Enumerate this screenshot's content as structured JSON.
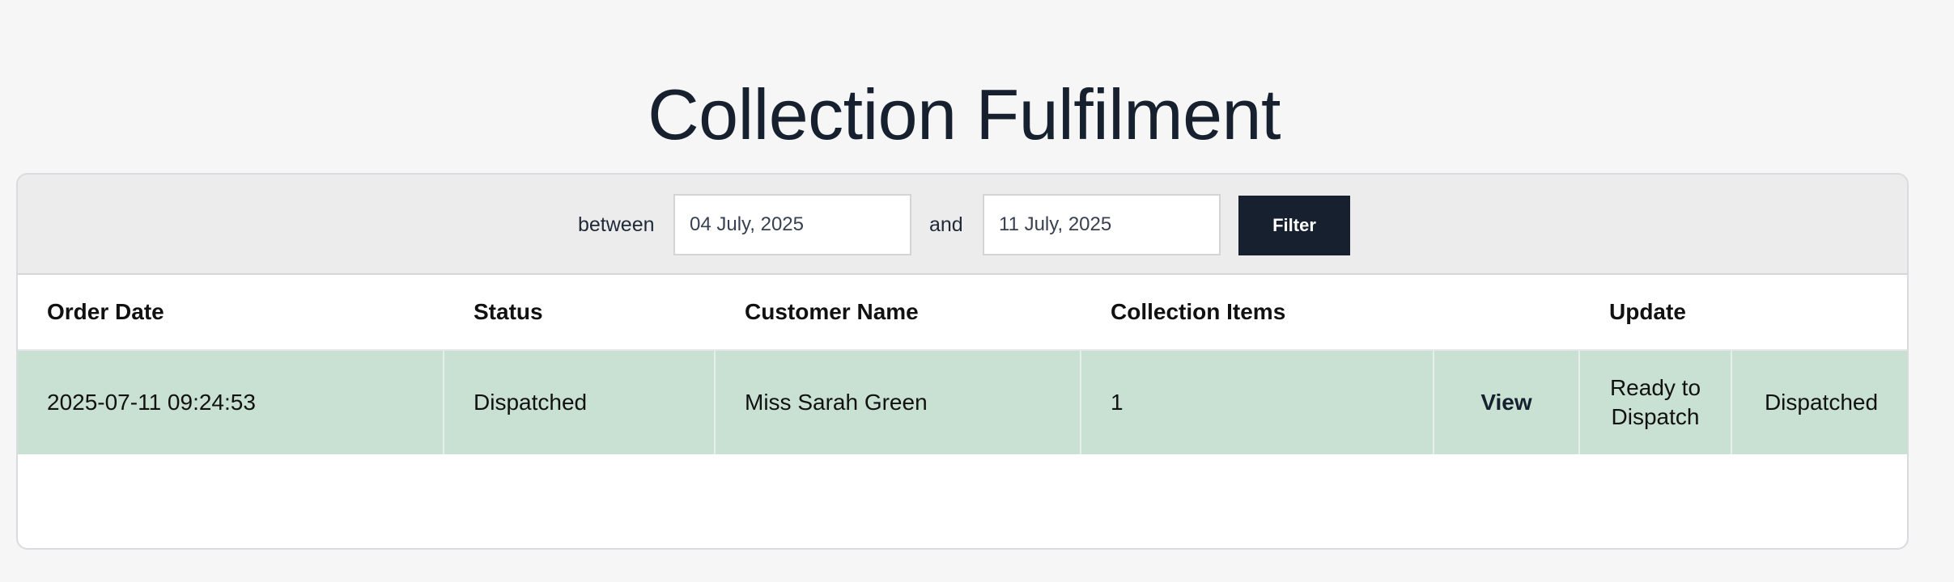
{
  "page": {
    "title": "Collection Fulfilment"
  },
  "filter": {
    "between_label": "between",
    "from_value": "04 July, 2025",
    "and_label": "and",
    "to_value": "11 July, 2025",
    "button_label": "Filter"
  },
  "table": {
    "headers": {
      "order_date": "Order Date",
      "status": "Status",
      "customer_name": "Customer Name",
      "collection_items": "Collection Items",
      "update": "Update"
    },
    "rows": [
      {
        "order_date": "2025-07-11 09:24:53",
        "status": "Dispatched",
        "customer_name": "Miss Sarah Green",
        "collection_items": "1",
        "view_label": "View",
        "ready_label": "Ready to Dispatch",
        "dispatched_label": "Dispatched"
      }
    ]
  },
  "colors": {
    "background": "#f6f6f6",
    "primary": "#16202f",
    "row_highlight": "#c8e1d2",
    "filter_bar": "#ececec"
  }
}
